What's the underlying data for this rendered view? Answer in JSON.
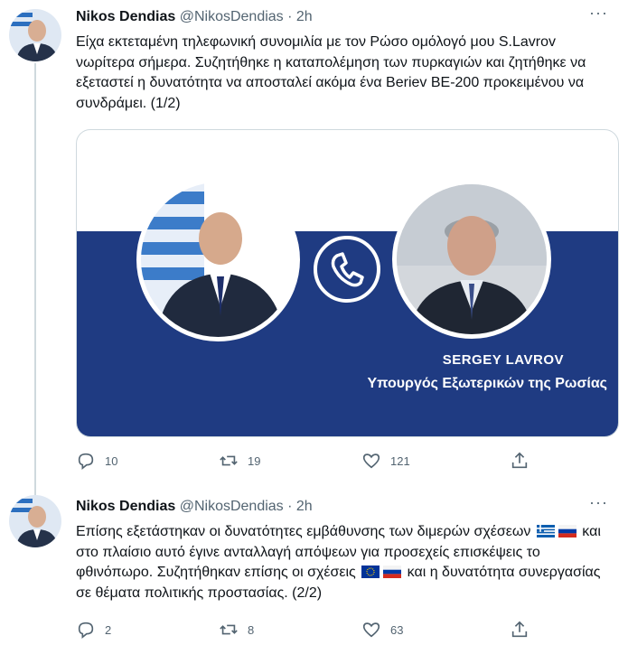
{
  "tweets": [
    {
      "author_name": "Nikos Dendias",
      "handle": "@NikosDendias",
      "time": "· 2h",
      "text": "Είχα εκτεταμένη τηλεφωνική συνομιλία με τον Ρώσο ομόλογό μου S.Lavrov νωρίτερα σήμερα. Συζητήθηκε η καταπολέμηση των πυρκαγιών και ζητήθηκε να εξεταστεί η δυνατότητα να αποσταλεί ακόμα ένα Beriev BE-200 προκειμένου να συνδράμει. (1/2)",
      "card": {
        "caption_name": "SERGEY LAVROV",
        "caption_role": "Υπουργός Εξωτερικών της Ρωσίας"
      },
      "stats": {
        "replies": "10",
        "retweets": "19",
        "likes": "121"
      }
    },
    {
      "author_name": "Nikos Dendias",
      "handle": "@NikosDendias",
      "time": "· 2h",
      "text_parts": [
        "Επίσης εξετάστηκαν οι δυνατότητες εμβάθυνσης των διμερών σχέσεων",
        "και στο πλαίσιο αυτό έγινε ανταλλαγή απόψεων για προσεχείς επισκέψεις το φθινόπωρο. Συζητήθηκαν επίσης οι σχέσεις",
        "και η δυνατότητα συνεργασίας σε θέματα πολιτικής προστασίας. (2/2)"
      ],
      "stats": {
        "replies": "2",
        "retweets": "8",
        "likes": "63"
      }
    }
  ],
  "icons": {
    "more": "more-icon",
    "reply": "reply-icon",
    "retweet": "retweet-icon",
    "like": "heart-icon",
    "share": "share-icon",
    "phone": "phone-icon"
  },
  "colors": {
    "brand_blue": "#1f3b82",
    "muted": "#536471",
    "divider": "#cfd9de"
  }
}
